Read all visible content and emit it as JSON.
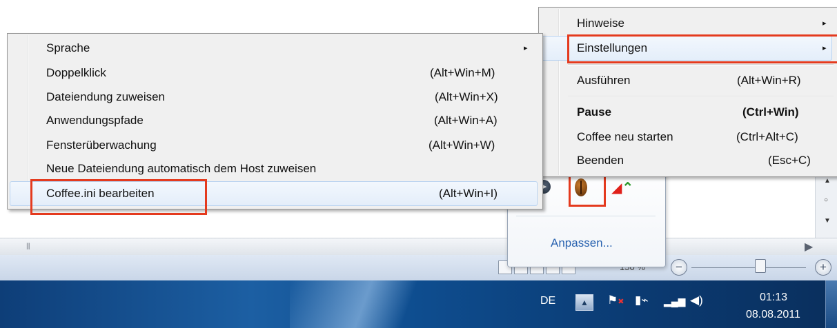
{
  "main_menu": {
    "items": [
      {
        "label": "Hinweise",
        "shortcut": "",
        "has_submenu": true
      },
      {
        "label": "Einstellungen",
        "shortcut": "",
        "has_submenu": true
      },
      {
        "label": "Ausführen",
        "shortcut": "(Alt+Win+R)"
      },
      {
        "label": "Pause",
        "shortcut": "(Ctrl+Win)",
        "bold": true
      },
      {
        "label": "Coffee neu starten",
        "shortcut": "(Ctrl+Alt+C)"
      },
      {
        "label": "Beenden",
        "shortcut": "(Esc+C)"
      }
    ],
    "submenu_arrow": "▸"
  },
  "settings_submenu": {
    "items": [
      {
        "label": "Sprache",
        "shortcut": "",
        "has_submenu": true
      },
      {
        "label": "Doppelklick",
        "shortcut": "(Alt+Win+M)"
      },
      {
        "label": "Dateiendung zuweisen",
        "shortcut": "(Alt+Win+X)"
      },
      {
        "label": "Anwendungspfade",
        "shortcut": "(Alt+Win+A)"
      },
      {
        "label": "Fensterüberwachung",
        "shortcut": "(Alt+Win+W)"
      },
      {
        "label": "Neue Dateiendung automatisch dem Host zuweisen",
        "shortcut": ""
      },
      {
        "label": "Coffee.ini bearbeiten",
        "shortcut": "(Alt+Win+I)"
      }
    ]
  },
  "tray_popup": {
    "customize_label": "Anpassen...",
    "icons": [
      "arrow-circle-icon",
      "coffee-bean-icon",
      "chart-icon"
    ]
  },
  "statusbar": {
    "zoom_text": "150 %",
    "minus": "−",
    "plus": "+"
  },
  "taskbar": {
    "language": "DE",
    "show_hidden_icon": "▲",
    "time": "01:13",
    "date": "08.08.2011",
    "tray_icons": [
      "action-center-flag-icon",
      "power-icon",
      "network-signal-icon",
      "volume-icon"
    ]
  },
  "highlight_color": "#e43a1e",
  "link_color": "#2a63b0"
}
